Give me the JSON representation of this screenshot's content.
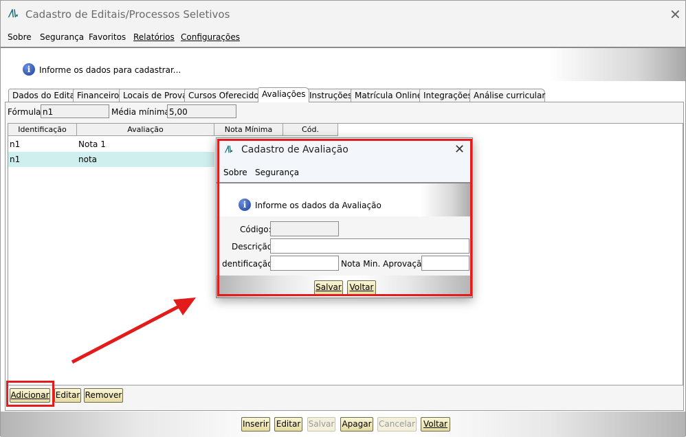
{
  "window": {
    "title": "Cadastro de Editais/Processos Seletivos",
    "close_glyph": "✕"
  },
  "menu": [
    {
      "label": "Sobre"
    },
    {
      "label": "Segurança"
    },
    {
      "label": "Favoritos"
    },
    {
      "label": "Relatórios"
    },
    {
      "label": "Configurações"
    }
  ],
  "info": {
    "icon": "info-icon",
    "message": "Informe os dados para cadastrar..."
  },
  "tabs": [
    {
      "label": "Dados do Edital"
    },
    {
      "label": "Financeiro"
    },
    {
      "label": "Locais de Prova"
    },
    {
      "label": "Cursos Oferecidos"
    },
    {
      "label": "Avaliações",
      "active": true
    },
    {
      "label": "Instruções"
    },
    {
      "label": "Matrícula Online"
    },
    {
      "label": "Integrações"
    },
    {
      "label": "Análise curricular"
    }
  ],
  "form": {
    "formula_label": "Fórmula:",
    "formula_value": "n1",
    "media_label": "Média mínima:",
    "media_value": "5,00"
  },
  "grid": {
    "columns": [
      "Identificação",
      "Avaliação",
      "Nota Mínima",
      "Cód."
    ],
    "rows": [
      {
        "identificacao": "n1",
        "avaliacao": "Nota 1",
        "selected": false
      },
      {
        "identificacao": "n1",
        "avaliacao": "nota",
        "selected": true
      }
    ]
  },
  "grid_buttons": {
    "add": "Adicionar",
    "edit": "Editar",
    "remove": "Remover"
  },
  "bottom_buttons": {
    "insert": "Inserir",
    "edit": "Editar",
    "save": "Salvar",
    "delete": "Apagar",
    "cancel": "Cancelar",
    "back": "Voltar"
  },
  "dialog": {
    "title": "Cadastro de Avaliação",
    "close_glyph": "✕",
    "menu": [
      {
        "label": "Sobre"
      },
      {
        "label": "Segurança"
      }
    ],
    "info_message": "Informe os dados da Avaliação",
    "codigo_label": "Código:",
    "codigo_value": "",
    "descricao_label": "Descrição:",
    "descricao_value": "",
    "identificacao_label": "dentificação:",
    "identificacao_value": "",
    "nota_label": "Nota Min. Aprovação:",
    "nota_value": "",
    "save_label": "Salvar",
    "back_label": "Voltar"
  },
  "colors": {
    "highlight_red": "#e31b1b",
    "selected_row": "#cfeeee",
    "button_fill": "#f2eab8",
    "logo_teal": "#1a6f72"
  }
}
